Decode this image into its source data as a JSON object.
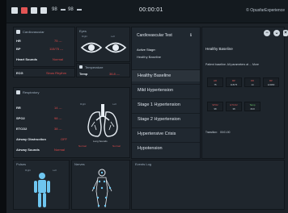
{
  "topbar": {
    "volume_1": "98",
    "volume_2": "98",
    "timer": "00:00:01",
    "brand": "© OpusfarExperience"
  },
  "cardio_panel": {
    "title": "Cardiovascular",
    "hr_label": "HR",
    "hr_value": "75 ---",
    "bp_label": "BP",
    "bp_value": "115/75 ---",
    "heart_sounds_label": "Heart Sounds",
    "heart_sounds_value": "Normal",
    "ecg_label": "ECG",
    "ecg_value": "Sinus Rhythm"
  },
  "eyes_panel": {
    "title": "Eyes",
    "right_label": "Right",
    "left_label": "Left"
  },
  "temp_panel": {
    "title": "Temperature",
    "temp_label": "Temp",
    "temp_value": "36.8 ---"
  },
  "resp_panel": {
    "title": "Respiratory",
    "rr_label": "RR",
    "rr_value": "14 ---",
    "spo2_label": "SPO2",
    "spo2_value": "98 ---",
    "etco2_label": "ETCO2",
    "etco2_value": "38 ---",
    "airway_obstruction_label": "Airway Obstruction",
    "airway_obstruction_value": "OFF",
    "airway_sounds_label": "Airway Sounds",
    "airway_sounds_value": "Normal",
    "lung_sounds_label": "Lung Sounds",
    "lung_right": "Right",
    "lung_left": "Left",
    "lung_normal_1": "Normal",
    "lung_normal_2": "Normal"
  },
  "pulses_panel": {
    "title": "Pulses",
    "right_label": "Right",
    "left_label": "Left"
  },
  "nerves_panel": {
    "title": "Nerves"
  },
  "events_panel": {
    "title": "Events Log"
  },
  "scenario": {
    "test_title": "Cardiovascular Test",
    "active_stage_label": "Active Stage:",
    "active_stage_value": "Healthy Baseline",
    "stages": [
      "Healthy Baseline",
      "Mild Hypertension",
      "Stage 1 Hypertension",
      "Stage 2 Hypertension",
      "Hypertensive Crisis",
      "Hypotension"
    ]
  },
  "detail": {
    "title": "Healthy Baseline",
    "description": "Patient baseline. All parameters at ... More",
    "params_row1": [
      {
        "key": "HR",
        "val": "75"
      },
      {
        "key": "BP",
        "val": "115/75"
      },
      {
        "key": "RR",
        "val": "14"
      },
      {
        "key": "BP",
        "val": "120/80"
      }
    ],
    "params_row2": [
      {
        "key": "SPO2",
        "val": "98"
      },
      {
        "key": "ETCO2",
        "val": "38"
      },
      {
        "key": "Temp",
        "val": "36.8"
      }
    ],
    "transition_label": "Transition:",
    "transition_value": "00:01:00"
  },
  "colors": {
    "alert": "#e04a4a",
    "body_figure": "#6ec6f0",
    "accent_green": "#6fcf6f"
  }
}
